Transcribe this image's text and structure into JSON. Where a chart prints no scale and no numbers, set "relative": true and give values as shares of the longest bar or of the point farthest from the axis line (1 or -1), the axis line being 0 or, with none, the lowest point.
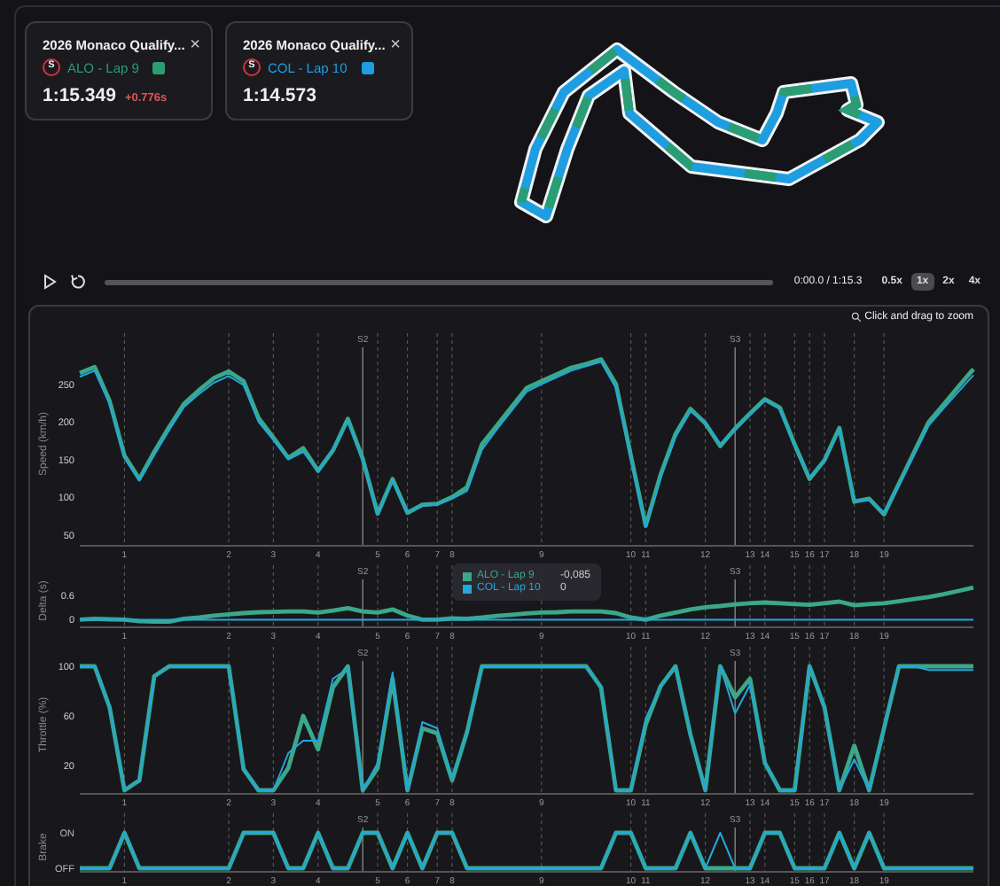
{
  "laps": [
    {
      "title": "2026 Monaco Qualify...",
      "close": "×",
      "tyre": "S",
      "driver": "ALO - Lap 9",
      "color": "#2a9d73",
      "time": "1:15.349",
      "delta": "+0.776s"
    },
    {
      "title": "2026 Monaco Qualify...",
      "close": "×",
      "tyre": "S",
      "driver": "COL - Lap 10",
      "color": "#1e9ee0",
      "time": "1:14.573"
    }
  ],
  "playback": {
    "time": "0:00.0 / 1:15.3",
    "level": 0,
    "speeds": [
      {
        "label": "0.5x",
        "selected": false
      },
      {
        "label": "1x",
        "selected": true
      },
      {
        "label": "2x",
        "selected": false
      },
      {
        "label": "4x",
        "selected": false
      }
    ]
  },
  "telemetry": {
    "zoom_hint": "Click and drag to zoom",
    "tooltip": {
      "values": [
        "-0,085",
        "0"
      ]
    },
    "panels": [
      {
        "chart_data": {
          "type": "line",
          "ylabel": "Speed (km/h)",
          "grid": true,
          "ylim": [
            40,
            292
          ],
          "yticks": [
            50,
            100,
            150,
            200,
            250
          ],
          "annotations": [
            "S2",
            "S3"
          ],
          "categories": [
            null,
            null,
            null,
            "1",
            null,
            null,
            null,
            null,
            null,
            null,
            "2",
            null,
            null,
            "3",
            null,
            null,
            "4",
            null,
            null,
            null,
            "5",
            null,
            "6",
            null,
            "7",
            "8",
            null,
            null,
            null,
            null,
            null,
            "9",
            null,
            null,
            null,
            null,
            null,
            "10",
            "11",
            null,
            null,
            null,
            "12",
            null,
            null,
            "13",
            "14",
            null,
            "15",
            "16",
            "17",
            null,
            "18",
            null,
            "19",
            null,
            null,
            null,
            null,
            null,
            null
          ],
          "series": [
            {
              "color": "#3aa88a",
              "values": [
                265,
                273,
                228,
                155,
                124,
                160,
                193,
                224,
                242,
                258,
                267,
                254,
                205,
                179,
                152,
                165,
                135,
                162,
                204,
                151,
                78,
                124,
                79,
                90,
                91,
                100,
                113,
                170,
                195,
                220,
                245,
                254,
                263,
                272,
                277,
                283,
                250,
                155,
                62,
                130,
                184,
                217,
                198,
                168,
                191,
                211,
                230,
                219,
                170,
                124,
                149,
                192,
                94,
                98,
                77,
                118,
                159,
                200,
                223,
                247,
                270
              ]
            },
            {
              "color": "#22a7dd",
              "values": [
                260,
                268,
                224,
                152,
                122,
                156,
                189,
                220,
                237,
                252,
                261,
                249,
                200,
                176,
                150,
                160,
                134,
                163,
                201,
                149,
                77,
                122,
                80,
                88,
                90,
                98,
                108,
                163,
                190,
                215,
                240,
                250,
                259,
                268,
                274,
                280,
                245,
                152,
                60,
                126,
                180,
                214,
                200,
                170,
                189,
                209,
                228,
                217,
                168,
                126,
                148,
                190,
                95,
                96,
                79,
                115,
                155,
                195,
                218,
                240,
                262
              ]
            }
          ]
        }
      },
      {
        "chart_data": {
          "type": "line",
          "ylabel": "Delta (s)",
          "grid": true,
          "legend": "top",
          "ylim": [
            -0.1,
            0.85
          ],
          "yticks": [
            0,
            0.6
          ],
          "annotations": [
            "S2",
            "S3"
          ],
          "categories": [
            null,
            null,
            null,
            "1",
            null,
            null,
            null,
            null,
            null,
            null,
            "2",
            null,
            null,
            "3",
            null,
            null,
            "4",
            null,
            null,
            null,
            "5",
            null,
            "6",
            null,
            "7",
            "8",
            null,
            null,
            null,
            null,
            null,
            "9",
            null,
            null,
            null,
            null,
            null,
            "10",
            "11",
            null,
            null,
            null,
            "12",
            null,
            null,
            "13",
            "14",
            null,
            "15",
            "16",
            "17",
            null,
            "18",
            null,
            "19",
            null,
            null,
            null,
            null,
            null,
            null
          ],
          "series": [
            {
              "name": "ALO - Lap 9",
              "color": "#3aa88a",
              "values": [
                0,
                0.02,
                0.01,
                0,
                -0.04,
                -0.05,
                -0.05,
                0.02,
                0.05,
                0.1,
                0.13,
                0.16,
                0.18,
                0.19,
                0.2,
                0.2,
                0.17,
                0.22,
                0.28,
                0.2,
                0.17,
                0.25,
                0.1,
                0,
                0,
                0.03,
                0.02,
                0.05,
                0.09,
                0.12,
                0.15,
                0.17,
                0.18,
                0.2,
                0.2,
                0.2,
                0.16,
                0.05,
                0,
                0.1,
                0.17,
                0.25,
                0.3,
                0.33,
                0.37,
                0.4,
                0.42,
                0.4,
                0.38,
                0.36,
                0.4,
                0.44,
                0.35,
                0.38,
                0.4,
                0.45,
                0.5,
                0.55,
                0.62,
                0.7,
                0.78
              ]
            },
            {
              "name": "COL - Lap 10",
              "color": "#22a7dd",
              "values": [
                0,
                0,
                0,
                0,
                0,
                0,
                0,
                0,
                0,
                0,
                0,
                0,
                0,
                0,
                0,
                0,
                0,
                0,
                0,
                0,
                0,
                0,
                0,
                0,
                0,
                0,
                0,
                0,
                0,
                0,
                0,
                0,
                0,
                0,
                0,
                0,
                0,
                0,
                0,
                0,
                0,
                0,
                0,
                0,
                0,
                0,
                0,
                0,
                0,
                0,
                0,
                0,
                0,
                0,
                0,
                0,
                0,
                0,
                0,
                0,
                0
              ]
            }
          ]
        }
      },
      {
        "chart_data": {
          "type": "line",
          "ylabel": "Throttle (%)",
          "grid": true,
          "ylim": [
            0,
            100
          ],
          "yticks": [
            20,
            60,
            100
          ],
          "annotations": [
            "S2",
            "S3"
          ],
          "categories": [
            null,
            null,
            null,
            "1",
            null,
            null,
            null,
            null,
            null,
            null,
            "2",
            null,
            null,
            "3",
            null,
            null,
            "4",
            null,
            null,
            null,
            "5",
            null,
            "6",
            null,
            "7",
            "8",
            null,
            null,
            null,
            null,
            null,
            "9",
            null,
            null,
            null,
            null,
            null,
            "10",
            "11",
            null,
            null,
            null,
            "12",
            null,
            null,
            "13",
            "14",
            null,
            "15",
            "16",
            "17",
            null,
            "18",
            null,
            "19",
            null,
            null,
            null,
            null,
            null,
            null
          ],
          "series": [
            {
              "color": "#3aa88a",
              "values": [
                100,
                100,
                67,
                0,
                8,
                92,
                100,
                100,
                100,
                100,
                100,
                17,
                0,
                0,
                18,
                60,
                33,
                83,
                100,
                0,
                18,
                90,
                0,
                50,
                46,
                8,
                47,
                100,
                100,
                100,
                100,
                100,
                100,
                100,
                100,
                83,
                0,
                0,
                53,
                84,
                100,
                45,
                0,
                100,
                75,
                90,
                22,
                0,
                0,
                100,
                67,
                0,
                36,
                0,
                50,
                100,
                100,
                100,
                100,
                100,
                100
              ]
            },
            {
              "color": "#22a7dd",
              "values": [
                100,
                100,
                67,
                0,
                8,
                92,
                100,
                100,
                100,
                100,
                100,
                17,
                0,
                0,
                30,
                40,
                40,
                90,
                98,
                0,
                22,
                95,
                0,
                55,
                50,
                10,
                45,
                100,
                100,
                100,
                100,
                100,
                100,
                100,
                100,
                83,
                0,
                0,
                58,
                84,
                100,
                45,
                0,
                100,
                62,
                85,
                22,
                0,
                0,
                100,
                67,
                0,
                25,
                0,
                50,
                100,
                100,
                97,
                97,
                97,
                97
              ]
            }
          ]
        }
      },
      {
        "state_labels": [
          "ON",
          "OFF"
        ],
        "chart_data": {
          "type": "line",
          "ylabel": "Brake",
          "grid": true,
          "relative": true,
          "ylim": [
            0,
            1
          ],
          "annotations": [
            "S2",
            "S3"
          ],
          "categories": [
            null,
            null,
            null,
            "1",
            null,
            null,
            null,
            null,
            null,
            null,
            "2",
            null,
            null,
            "3",
            null,
            null,
            "4",
            null,
            null,
            null,
            "5",
            null,
            "6",
            null,
            "7",
            "8",
            null,
            null,
            null,
            null,
            null,
            "9",
            null,
            null,
            null,
            null,
            null,
            "10",
            "11",
            null,
            null,
            null,
            "12",
            null,
            null,
            "13",
            "14",
            null,
            "15",
            "16",
            "17",
            null,
            "18",
            null,
            "19",
            null,
            null,
            null,
            null,
            null,
            null
          ],
          "series": [
            {
              "color": "#3aa88a",
              "values": [
                0,
                0,
                0,
                1,
                0,
                0,
                0,
                0,
                0,
                0,
                0,
                1,
                1,
                1,
                0,
                0,
                1,
                0,
                0,
                1,
                1,
                0,
                1,
                0,
                1,
                1,
                0,
                0,
                0,
                0,
                0,
                0,
                0,
                0,
                0,
                0,
                1,
                1,
                0,
                0,
                0,
                1,
                0,
                0,
                0,
                0,
                1,
                1,
                0,
                0,
                0,
                1,
                0,
                1,
                0,
                0,
                0,
                0,
                0,
                0,
                0
              ]
            },
            {
              "color": "#22a7dd",
              "values": [
                0,
                0,
                0,
                1,
                0,
                0,
                0,
                0,
                0,
                0,
                0,
                1,
                1,
                1,
                0,
                0,
                1,
                0,
                0,
                1,
                1,
                0,
                1,
                0,
                1,
                1,
                0,
                0,
                0,
                0,
                0,
                0,
                0,
                0,
                0,
                0,
                1,
                1,
                0,
                0,
                0,
                1,
                0,
                1,
                0,
                0,
                1,
                1,
                0,
                0,
                0,
                1,
                0,
                1,
                0,
                0,
                0,
                0,
                0,
                0,
                0
              ]
            }
          ]
        }
      }
    ]
  }
}
